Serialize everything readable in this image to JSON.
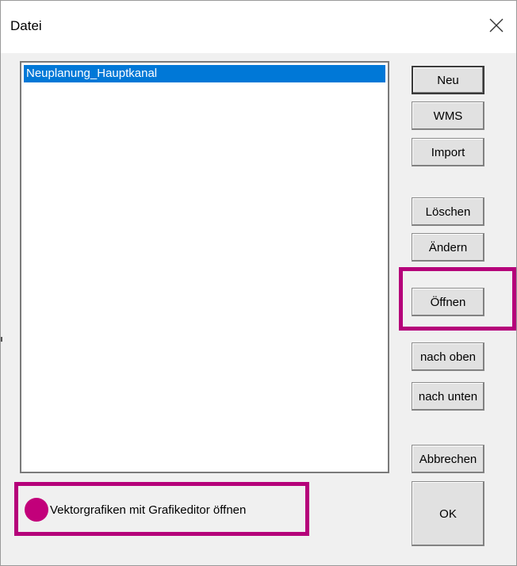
{
  "window": {
    "title": "Datei"
  },
  "list": {
    "items": [
      "Neuplanung_Hauptkanal"
    ],
    "selected_index": 0
  },
  "buttons": {
    "neu": "Neu",
    "wms": "WMS",
    "import": "Import",
    "loeschen": "Löschen",
    "aendern": "Ändern",
    "oeffnen": "Öffnen",
    "nach_oben": "nach oben",
    "nach_unten": "nach unten",
    "abbrechen": "Abbrechen",
    "ok": "OK"
  },
  "checkbox": {
    "label": "Vektorgrafiken mit Grafikeditor öffnen"
  },
  "colors": {
    "selection": "#0078d7",
    "highlight": "#b5007a",
    "dialog_bg": "#f0f0f0"
  },
  "icons": {
    "close": "close-icon"
  }
}
